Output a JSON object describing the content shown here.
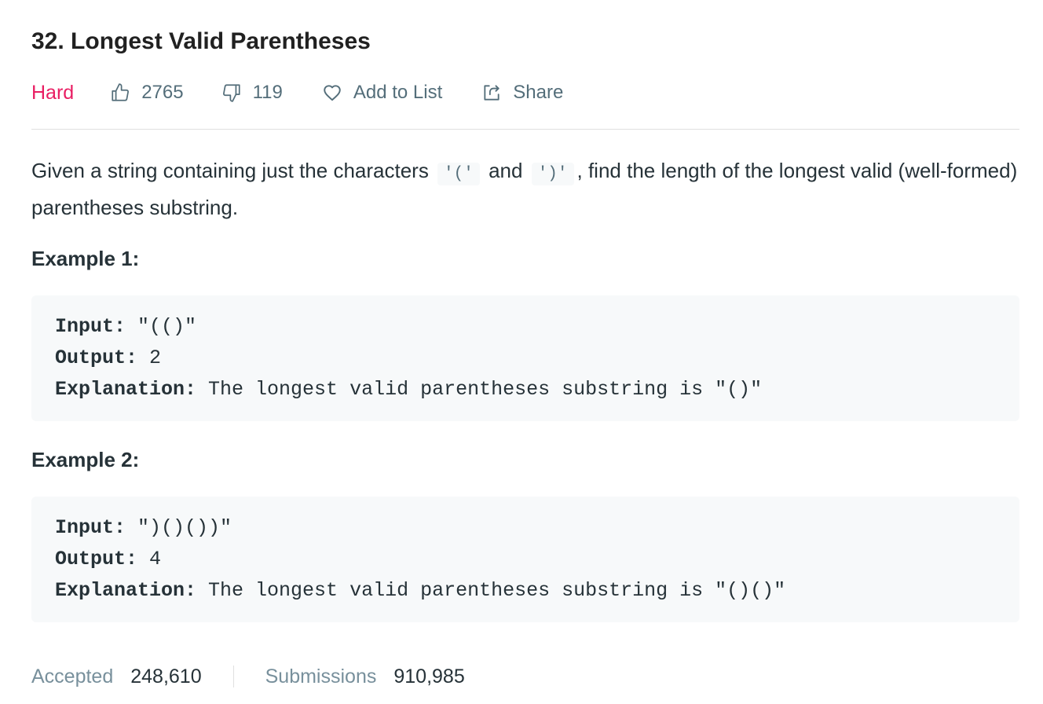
{
  "problem": {
    "title": "32. Longest Valid Parentheses",
    "difficulty": "Hard",
    "difficulty_color": "#e91e63",
    "likes": "2765",
    "dislikes": "119",
    "add_to_list_label": "Add to List",
    "share_label": "Share"
  },
  "description": {
    "part1": "Given a string containing just the characters ",
    "code1": "'('",
    "part2": " and ",
    "code2": "')'",
    "part3": ", find the length of the longest valid (well-formed) parentheses substring."
  },
  "examples": [
    {
      "title": "Example 1:",
      "input_label": "Input:",
      "input_value": " \"(()\"",
      "output_label": "Output:",
      "output_value": " 2",
      "explanation_label": "Explanation:",
      "explanation_value": " The longest valid parentheses substring is \"()\""
    },
    {
      "title": "Example 2:",
      "input_label": "Input:",
      "input_value": " \")()())\"",
      "output_label": "Output:",
      "output_value": " 4",
      "explanation_label": "Explanation:",
      "explanation_value": " The longest valid parentheses substring is \"()()\""
    }
  ],
  "stats": {
    "accepted_label": "Accepted",
    "accepted_value": "248,610",
    "submissions_label": "Submissions",
    "submissions_value": "910,985"
  },
  "icons": {
    "like": "thumbs-up-icon",
    "dislike": "thumbs-down-icon",
    "add": "heart-icon",
    "share": "share-icon"
  }
}
